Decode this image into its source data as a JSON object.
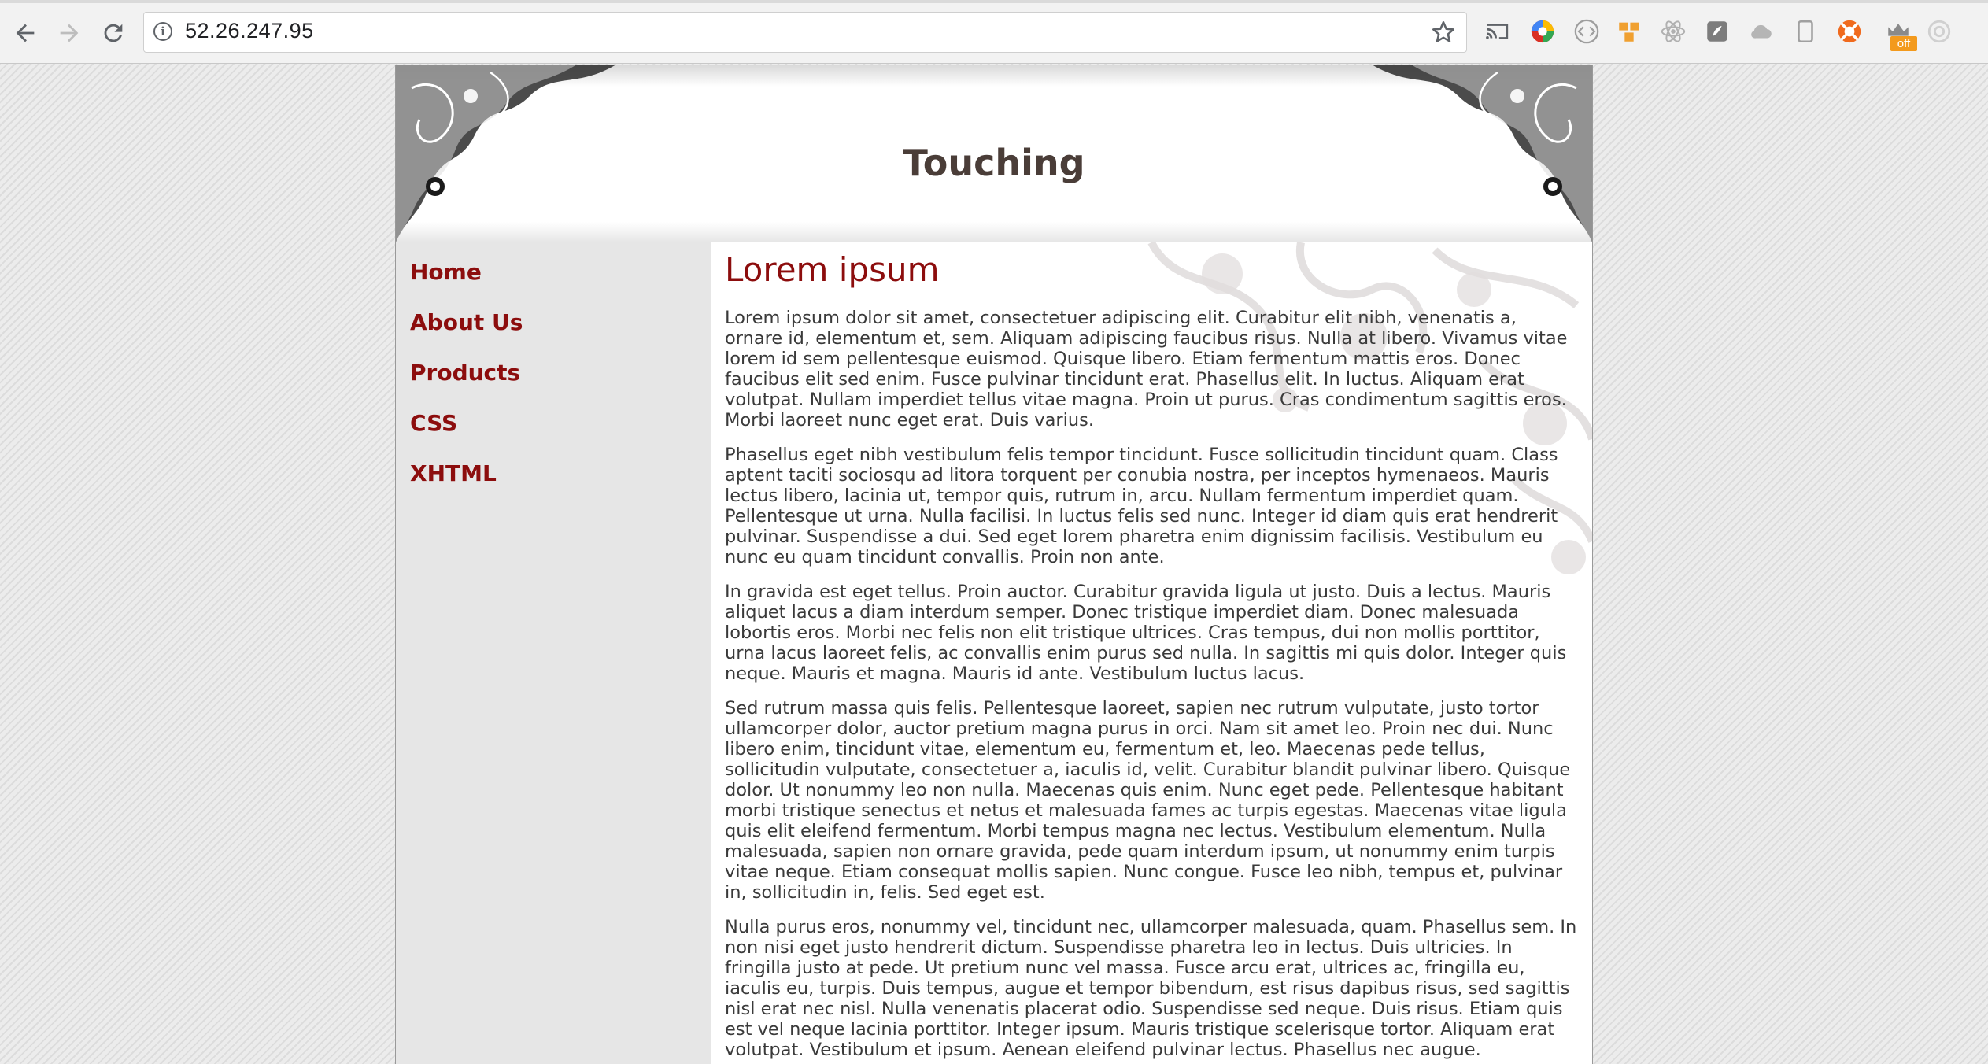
{
  "browser": {
    "url": "52.26.247.95",
    "ext_badge": "off"
  },
  "site": {
    "title": "Touching"
  },
  "nav": {
    "items": [
      {
        "label": "Home"
      },
      {
        "label": "About Us"
      },
      {
        "label": "Products"
      },
      {
        "label": "CSS"
      },
      {
        "label": "XHTML"
      }
    ]
  },
  "content": {
    "heading": "Lorem ipsum",
    "paragraphs": [
      "Lorem ipsum dolor sit amet, consectetuer adipiscing elit. Curabitur elit nibh, venenatis a, ornare id, elementum et, sem. Aliquam adipiscing faucibus risus. Nulla at libero. Vivamus vitae lorem id sem pellentesque euismod. Quisque libero. Etiam fermentum mattis eros. Donec faucibus elit sed enim. Fusce pulvinar tincidunt erat. Phasellus elit. In luctus. Aliquam erat volutpat. Nullam imperdiet tellus vitae magna. Proin ut purus. Cras condimentum sagittis eros. Morbi laoreet nunc eget erat. Duis varius.",
      "Phasellus eget nibh vestibulum felis tempor tincidunt. Fusce sollicitudin tincidunt quam. Class aptent taciti sociosqu ad litora torquent per conubia nostra, per inceptos hymenaeos. Mauris lectus libero, lacinia ut, tempor quis, rutrum in, arcu. Nullam fermentum imperdiet quam. Pellentesque ut urna. Nulla facilisi. In luctus felis sed nunc. Integer id diam quis erat hendrerit pulvinar. Suspendisse a dui. Sed eget lorem pharetra enim dignissim facilisis. Vestibulum eu nunc eu quam tincidunt convallis. Proin non ante.",
      "In gravida est eget tellus. Proin auctor. Curabitur gravida ligula ut justo. Duis a lectus. Mauris aliquet lacus a diam interdum semper. Donec tristique imperdiet diam. Donec malesuada lobortis eros. Morbi nec felis non elit tristique ultrices. Cras tempus, dui non mollis porttitor, urna lacus laoreet felis, ac convallis enim purus sed nulla. In sagittis mi quis dolor. Integer quis neque. Mauris et magna. Mauris id ante. Vestibulum luctus lacus.",
      "Sed rutrum massa quis felis. Pellentesque laoreet, sapien nec rutrum vulputate, justo tortor ullamcorper dolor, auctor pretium magna purus in orci. Nam sit amet leo. Proin nec dui. Nunc libero enim, tincidunt vitae, elementum eu, fermentum et, leo. Maecenas pede tellus, sollicitudin vulputate, consectetuer a, iaculis id, velit. Curabitur blandit pulvinar libero. Quisque dolor. Ut nonummy leo non nulla. Maecenas quis enim. Nunc eget pede. Pellentesque habitant morbi tristique senectus et netus et malesuada fames ac turpis egestas. Maecenas vitae ligula quis elit eleifend fermentum. Morbi tempus magna nec lectus. Vestibulum elementum. Nulla malesuada, sapien non ornare gravida, pede quam interdum ipsum, ut nonummy enim turpis vitae neque. Etiam consequat mollis sapien. Nunc congue. Fusce leo nibh, tempus et, pulvinar in, sollicitudin in, felis. Sed eget est.",
      "Nulla purus eros, nonummy vel, tincidunt nec, ullamcorper malesuada, quam. Phasellus sem. In non nisi eget justo hendrerit dictum. Suspendisse pharetra leo in lectus. Duis ultricies. In fringilla justo at pede. Ut pretium nunc vel massa. Fusce arcu erat, ultrices ac, fringilla eu, iaculis eu, turpis. Duis tempus, augue et tempor bibendum, est risus dapibus risus, sed sagittis nisl erat nec nisl. Nulla venenatis placerat odio. Suspendisse sed neque. Duis risus. Etiam quis est vel neque lacinia porttitor. Integer ipsum. Mauris tristique scelerisque tortor. Aliquam erat volutpat. Vestibulum et ipsum. Aenean eleifend pulvinar lectus. Phasellus nec augue."
    ]
  },
  "colors": {
    "accent": "#8c0d0d",
    "title": "#4a3d38",
    "text": "#3a3a3a",
    "sidebar_bg": "#e6e6e6"
  },
  "icons": {
    "back": "back-arrow-icon",
    "forward": "forward-arrow-icon",
    "reload": "reload-icon",
    "info": "info-icon",
    "bookmark": "star-icon",
    "extensions": [
      "cast-icon",
      "color-picker-icon",
      "code-bracket-icon",
      "box-icon",
      "react-icon",
      "shield-icon",
      "cloud-icon",
      "tablet-icon",
      "lifebuoy-icon",
      "crown-off-icon",
      "spinner-icon"
    ]
  }
}
